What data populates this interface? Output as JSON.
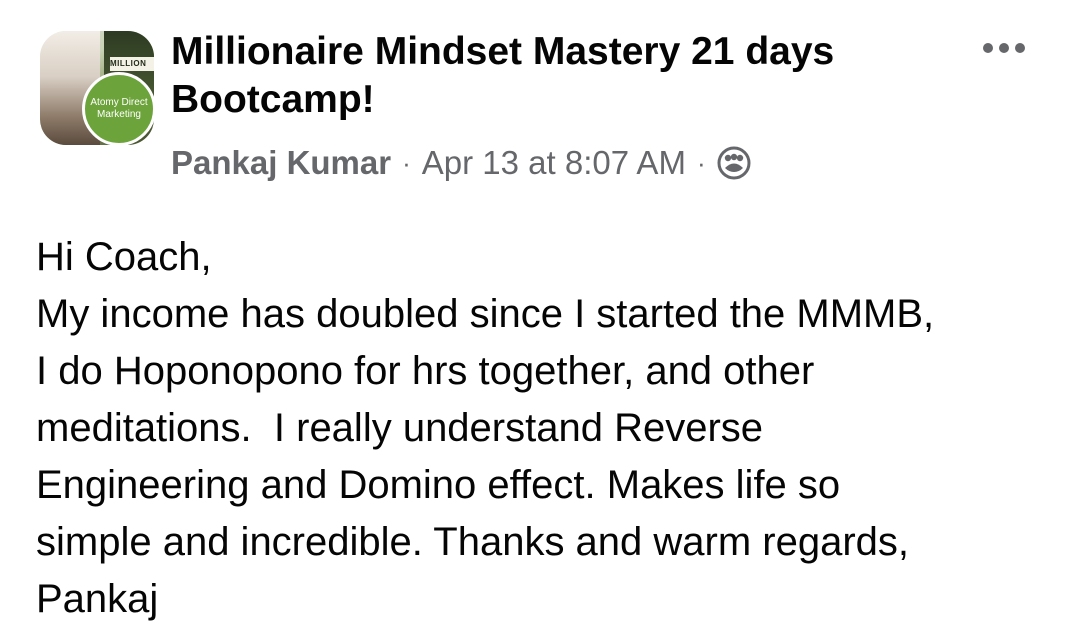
{
  "post": {
    "group_name": "Millionaire Mindset Mastery 21 days Bootcamp!",
    "group_badge_text": "Atomy Direct Marketing",
    "avatar_sign_text": "MILLION",
    "author": "Pankaj Kumar",
    "separator": "·",
    "timestamp": "Apr 13 at 8:07 AM",
    "privacy_icon": "members-icon",
    "more_icon": "more-options-icon",
    "body_lines": [
      "Hi Coach,",
      "My income has doubled since I started the MMMB,",
      "I do Hoponopono for hrs together, and other",
      "meditations.  I really understand Reverse",
      "Engineering and Domino effect. Makes life so",
      "simple and incredible. Thanks and warm regards,",
      "Pankaj"
    ]
  },
  "colors": {
    "text_primary": "#050505",
    "text_secondary": "#65676b",
    "badge_green": "#6ca33a",
    "background": "#ffffff"
  }
}
